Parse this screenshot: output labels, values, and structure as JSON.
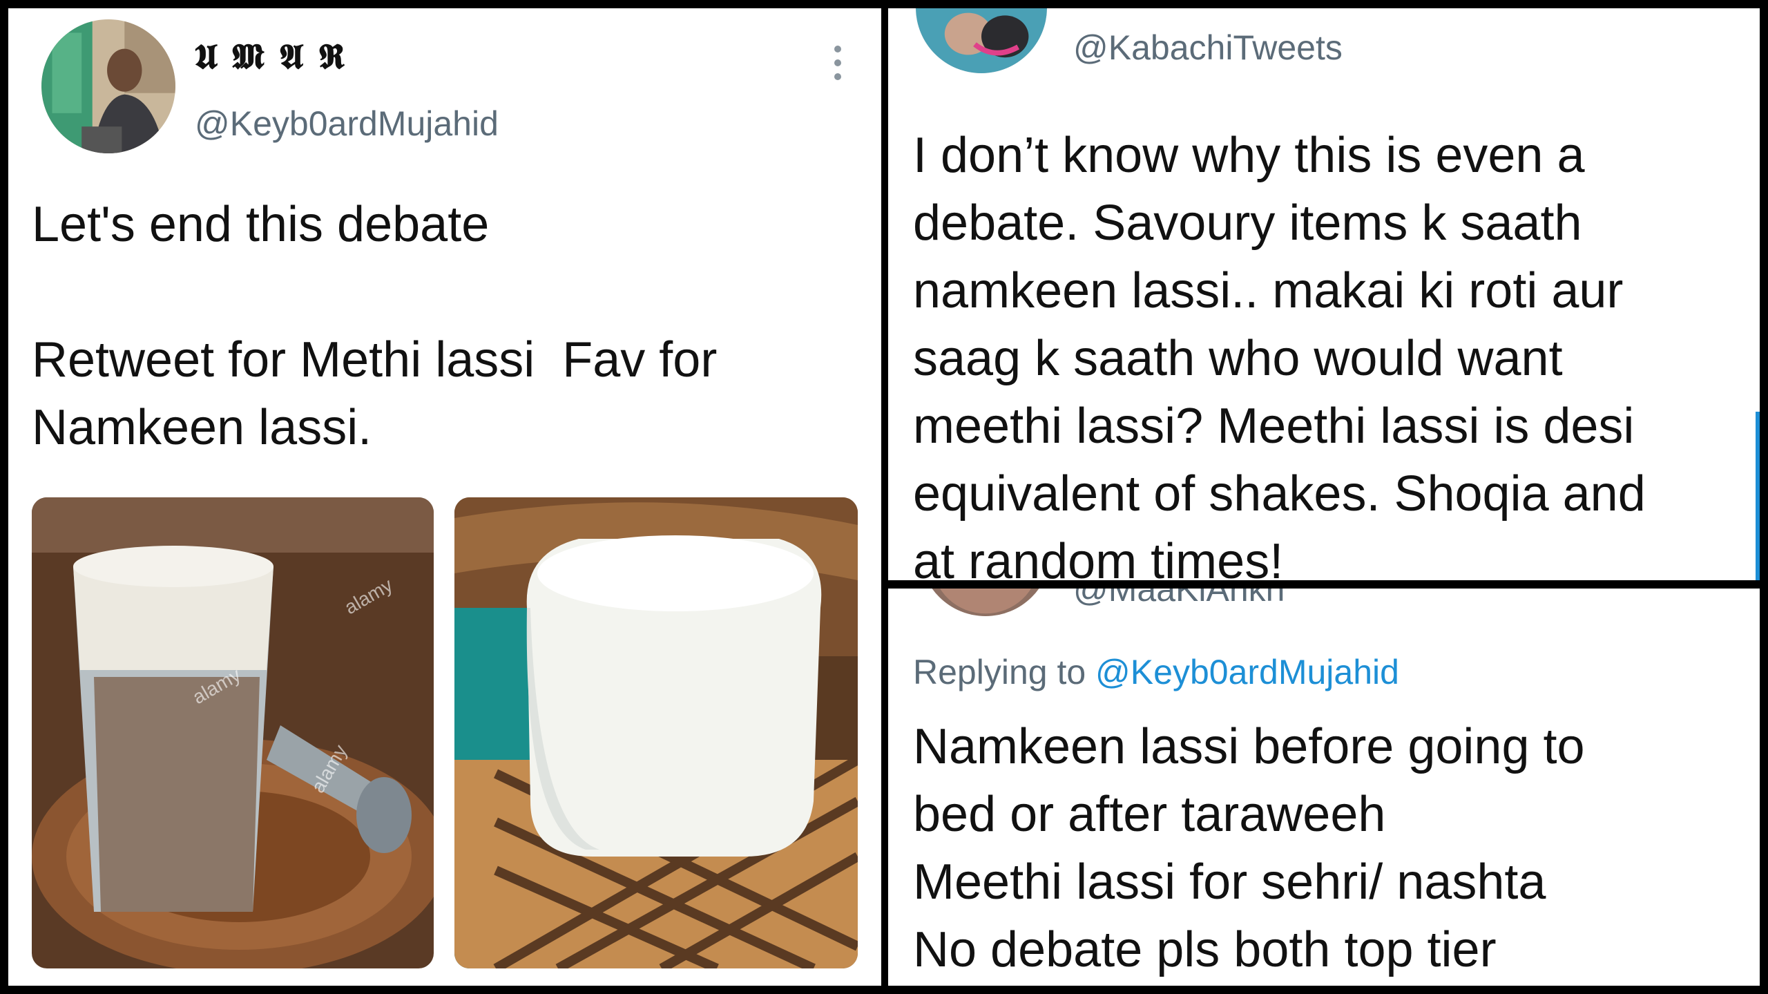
{
  "tweet1": {
    "display_name": "𝖀 𝕸 𝕬 𝕽",
    "handle": "@Keyb0ardMujahid",
    "text": "Let's end this debate\n\nRetweet for Methi lassi  Fav for\nNamkeen lassi.",
    "media": [
      {
        "watermark": "alamy"
      },
      {
        "watermark": ""
      }
    ]
  },
  "tweet2": {
    "handle": "@KabachiTweets",
    "text": "I don’t know why this is even a\ndebate. Savoury items k saath\nnamkeen lassi.. makai ki roti aur\nsaag k saath who would want\nmeethi lassi? Meethi lassi is desi\nequivalent of shakes. Shoqia and\nat random times!"
  },
  "tweet3": {
    "handle_cut": "@MaaKiAnkh",
    "replying_prefix": "Replying to ",
    "replying_to": "@Keyb0ardMujahid",
    "text": "Namkeen lassi before going to\nbed or after taraweeh\nMeethi lassi for sehri/ nashta\nNo debate pls both top tier"
  },
  "colors": {
    "handle_gray": "#5b6b78",
    "mention_blue": "#1d8fd6",
    "text": "#111111"
  }
}
